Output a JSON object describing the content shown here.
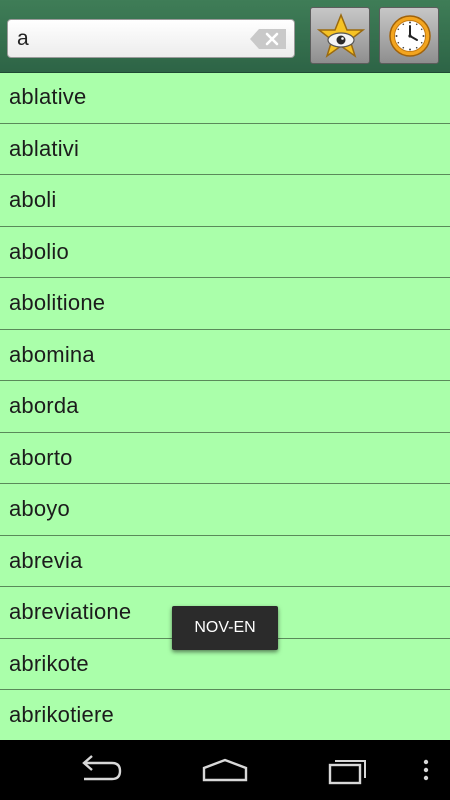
{
  "search": {
    "value": "a"
  },
  "toolbar": {
    "favorites_icon": "star-eye-icon",
    "history_icon": "clock-icon"
  },
  "words": [
    "ablative",
    "ablativi",
    "aboli",
    "abolio",
    "abolitione",
    "abomina",
    "aborda",
    "aborto",
    "aboyo",
    "abrevia",
    "abreviatione",
    "abrikote",
    "abrikotiere"
  ],
  "toast": {
    "label": "NOV-EN"
  },
  "navbar": {
    "icons": [
      "back-icon",
      "home-icon",
      "recents-icon",
      "overflow-menu-icon"
    ]
  },
  "colors": {
    "list_bg": "#aaffaa",
    "topbar": "#2d6446",
    "toast_bg": "#2b2b2b"
  }
}
